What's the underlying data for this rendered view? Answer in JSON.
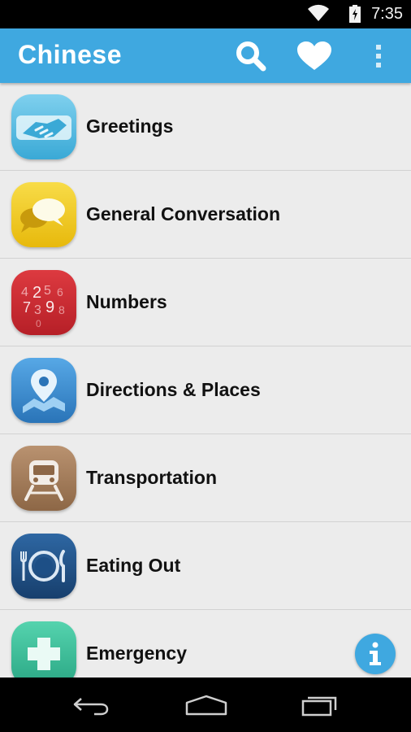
{
  "status_bar": {
    "time": "7:35",
    "icons": [
      "wifi-icon",
      "battery-charging-icon"
    ]
  },
  "app_bar": {
    "title": "Chinese",
    "actions": [
      "search-icon",
      "heart-icon",
      "overflow-menu-icon"
    ]
  },
  "categories": [
    {
      "label": "Greetings",
      "icon": "handshake-icon",
      "color": "#4cb6e0"
    },
    {
      "label": "General Conversation",
      "icon": "speech-bubbles-icon",
      "color": "#f1c40f"
    },
    {
      "label": "Numbers",
      "icon": "numbers-icon",
      "color": "#c7282f"
    },
    {
      "label": "Directions & Places",
      "icon": "map-pin-icon",
      "color": "#3b8fd0"
    },
    {
      "label": "Transportation",
      "icon": "train-icon",
      "color": "#a07a56"
    },
    {
      "label": "Eating Out",
      "icon": "plate-cutlery-icon",
      "color": "#1d4f86"
    },
    {
      "label": "Emergency",
      "icon": "medical-cross-icon",
      "color": "#3bbf9a"
    }
  ],
  "fab": {
    "icon": "info-icon",
    "label": "i",
    "color": "#3fa8e0"
  },
  "nav_bar": [
    "back-icon",
    "home-icon",
    "recent-apps-icon"
  ]
}
